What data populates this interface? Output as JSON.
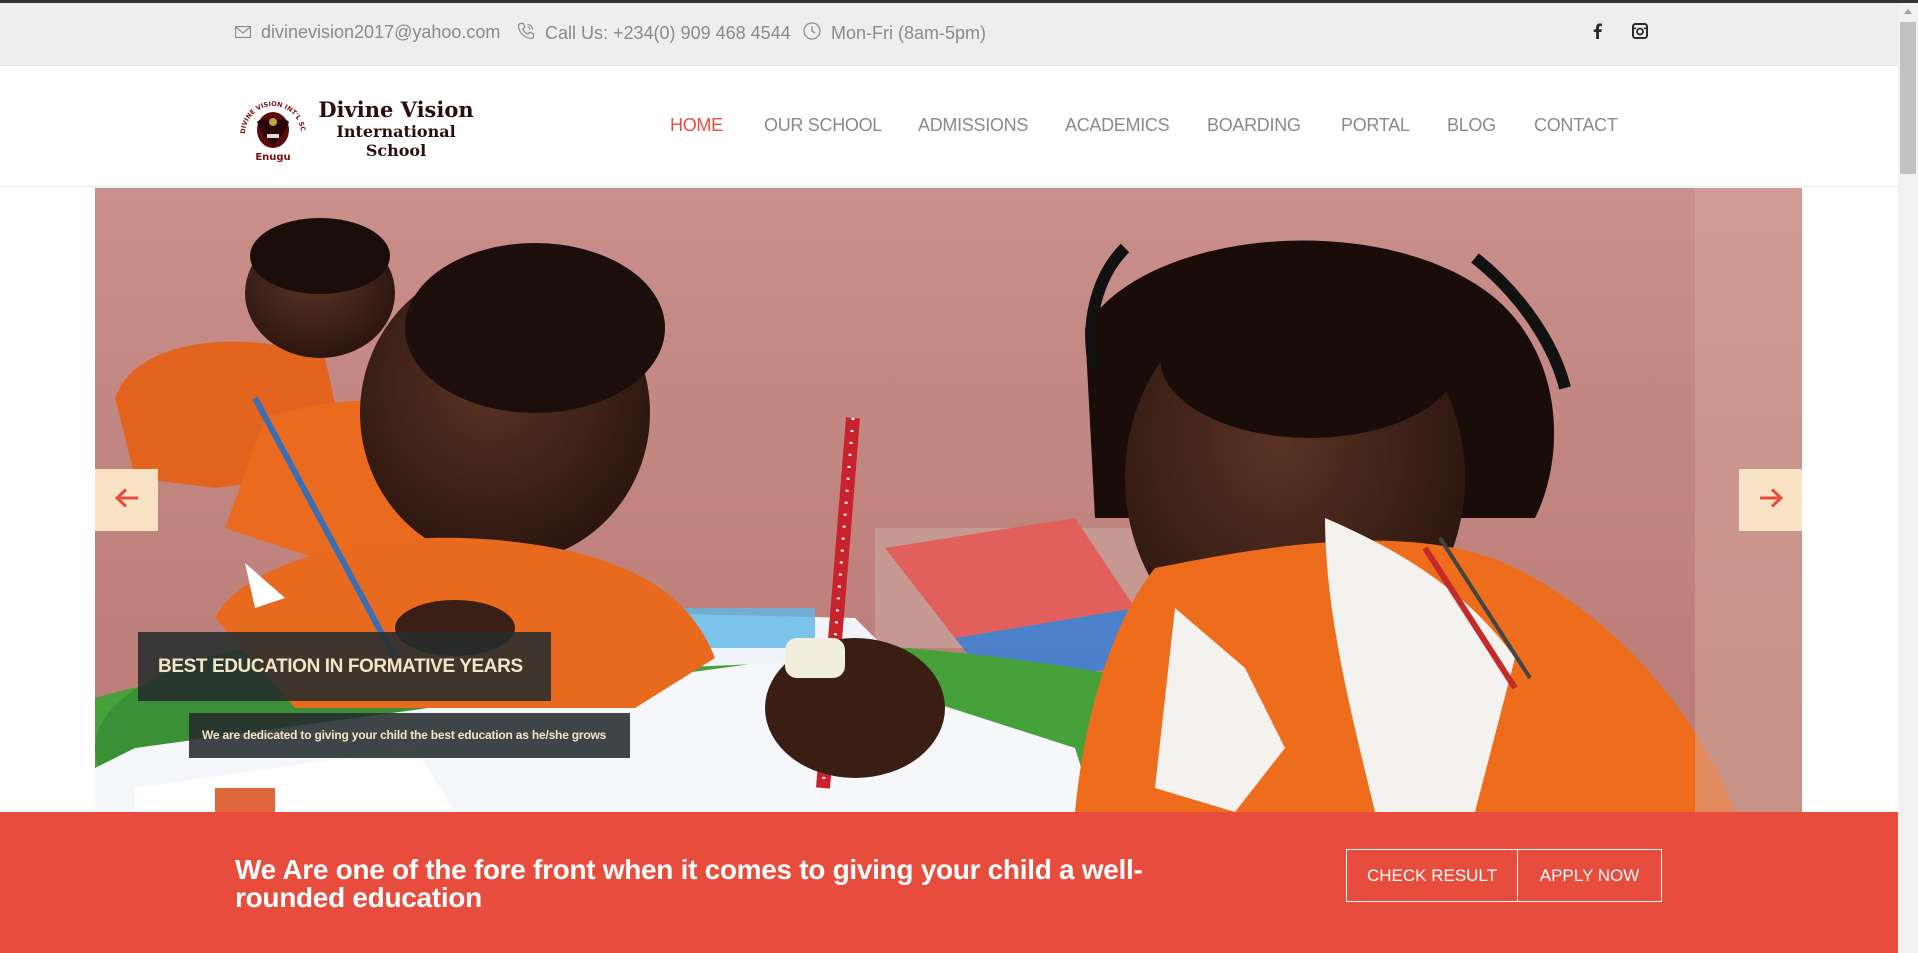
{
  "topbar": {
    "email": "divinevision2017@yahoo.com",
    "phone": "Call Us: +234(0) 909 468 4544",
    "hours": "Mon-Fri (8am-5pm)",
    "icons": [
      "envelope-icon",
      "phone-icon",
      "clock-icon",
      "facebook-icon",
      "instagram-icon"
    ]
  },
  "logo": {
    "line1": "Divine Vision",
    "line2": "International",
    "line3": "School",
    "seal_ring_text": "DIVINE VISION INT'L SCHOOL",
    "seal_bottom_text": "Enugu"
  },
  "nav": {
    "items": [
      "HOME",
      "OUR SCHOOL",
      "ADMISSIONS",
      "ACADEMICS",
      "BOARDING",
      "PORTAL",
      "BLOG",
      "CONTACT"
    ],
    "active": "HOME"
  },
  "slider": {
    "caption_title": "BEST EDUCATION IN FORMATIVE YEARS",
    "caption_subtitle": "We are dedicated to giving your child the best education as he/she grows"
  },
  "cta": {
    "text": "We Are one of the fore front when it comes to giving your child a well-rounded education",
    "check_result": "CHECK RESULT",
    "apply_now": "APPLY NOW"
  },
  "colors": {
    "accent": "#e74c3c",
    "topbar_bg": "#eeeeee",
    "nav_text": "#8a8a8a",
    "caption_bg": "#262c2e",
    "caption_text": "#f3e6c5",
    "arrow_bg": "#f9e3c4"
  }
}
